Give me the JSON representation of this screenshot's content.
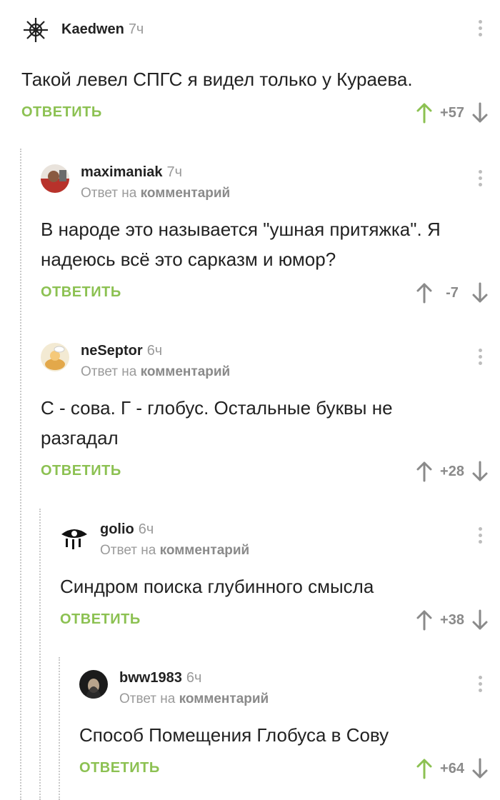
{
  "comments": [
    {
      "author": "Kaedwen",
      "time": "7ч",
      "reply_prefix": "",
      "reply_link": "",
      "text": "Такой левел СПГС я видел только у Кураева.",
      "reply_label": "ОТВЕТИТЬ",
      "rating": "+57",
      "up_active": true
    },
    {
      "author": "maximaniak",
      "time": "7ч",
      "reply_prefix": "Ответ на",
      "reply_link": "комментарий",
      "text": "В народе это называется \"ушная притяжка\". Я надеюсь всё это сарказм и юмор?",
      "reply_label": "ОТВЕТИТЬ",
      "rating": "-7",
      "up_active": false
    },
    {
      "author": "neSeptor",
      "time": "6ч",
      "reply_prefix": "Ответ на",
      "reply_link": "комментарий",
      "text": "С - сова. Г - глобус. Остальные буквы не разгадал",
      "reply_label": "ОТВЕТИТЬ",
      "rating": "+28",
      "up_active": false
    },
    {
      "author": "golio",
      "time": "6ч",
      "reply_prefix": "Ответ на",
      "reply_link": "комментарий",
      "text": "Синдром поиска глубинного смысла",
      "reply_label": "ОТВЕТИТЬ",
      "rating": "+38",
      "up_active": false
    },
    {
      "author": "bww1983",
      "time": "6ч",
      "reply_prefix": "Ответ на",
      "reply_link": "комментарий",
      "text": "Способ Помещения Глобуса в Сову",
      "reply_label": "ОТВЕТИТЬ",
      "rating": "+64",
      "up_active": true
    }
  ],
  "colors": {
    "accent": "#8cc152",
    "muted": "#9a9a9a",
    "thread_line": "#c9c9c9"
  },
  "icons": [
    "star-emblem-avatar",
    "user-photo-avatar",
    "cartoon-avatar",
    "eye-emblem-avatar",
    "dark-portrait-avatar",
    "more-vertical-icon",
    "arrow-up-icon",
    "arrow-down-icon"
  ]
}
